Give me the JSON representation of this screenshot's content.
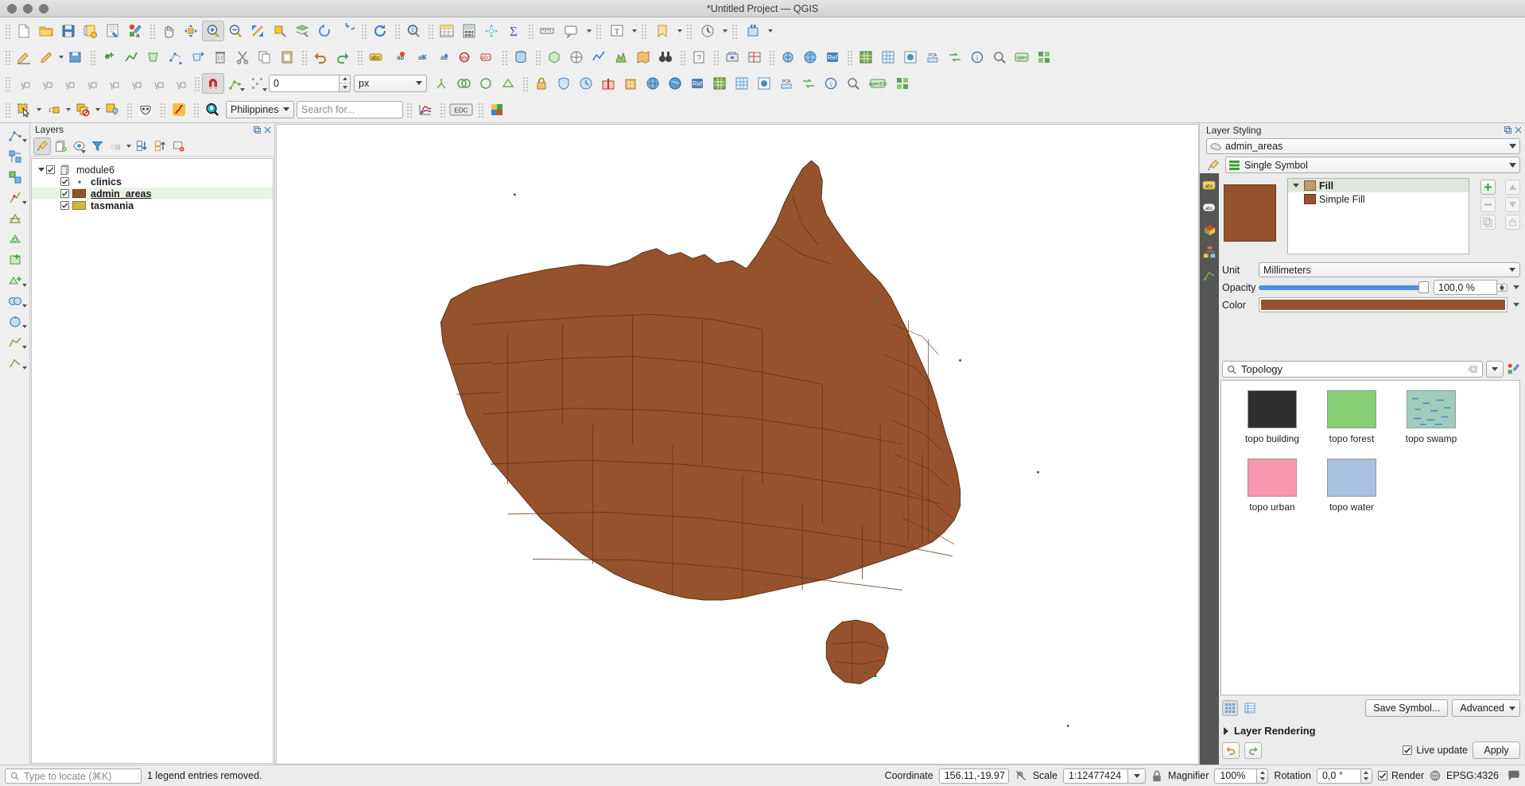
{
  "window": {
    "title": "*Untitled Project — QGIS"
  },
  "toolbar2": {
    "offset_value": "0",
    "unit_value": "px"
  },
  "toolbar3": {
    "region_value": "Philippines",
    "search_placeholder": "Search for..."
  },
  "layers_panel": {
    "title": "Layers",
    "tree": [
      {
        "label": "module6",
        "type": "group",
        "checked": true,
        "symbol": "none"
      },
      {
        "label": "clinics",
        "type": "layer",
        "checked": true,
        "symbol": "point",
        "color": "#4a7a3a"
      },
      {
        "label": "admin_areas",
        "type": "layer",
        "checked": true,
        "symbol": "fill",
        "color": "#96522c",
        "selected": true
      },
      {
        "label": "tasmania",
        "type": "layer",
        "checked": true,
        "symbol": "fill",
        "color": "#d4b63c"
      }
    ]
  },
  "styling": {
    "title": "Layer Styling",
    "layer_name": "admin_areas",
    "renderer": "Single Symbol",
    "symbol_layers": [
      {
        "label": "Fill",
        "indent": 0,
        "color": "#c39a6b",
        "selected": true
      },
      {
        "label": "Simple Fill",
        "indent": 1,
        "color": "#96522c",
        "selected": false
      }
    ],
    "properties": {
      "unit_label": "Unit",
      "unit_value": "Millimeters",
      "opacity_label": "Opacity",
      "opacity_value": "100,0 %",
      "opacity_percent": 100,
      "color_label": "Color",
      "color_value": "#96522c"
    },
    "symbol_browser": {
      "search_value": "Topology",
      "items": [
        {
          "name": "topo building",
          "color": "#2e2e2e"
        },
        {
          "name": "topo forest",
          "color": "#85ce74"
        },
        {
          "name": "topo swamp",
          "color": "#9ecdbc"
        },
        {
          "name": "topo urban",
          "color": "#fa96ae"
        },
        {
          "name": "topo water",
          "color": "#a9c1e0"
        }
      ]
    },
    "save_symbol_label": "Save Symbol...",
    "advanced_label": "Advanced",
    "layer_rendering_label": "Layer Rendering",
    "live_update_label": "Live update",
    "live_update_checked": true,
    "apply_label": "Apply"
  },
  "statusbar": {
    "locate_placeholder": "Type to locate (⌘K)",
    "message": "1 legend entries removed.",
    "coordinate_label": "Coordinate",
    "coordinate_value": "156.11,-19.97",
    "scale_label": "Scale",
    "scale_value": "1:12477424",
    "magnifier_label": "Magnifier",
    "magnifier_value": "100%",
    "rotation_label": "Rotation",
    "rotation_value": "0,0 °",
    "render_label": "Render",
    "render_checked": true,
    "crs_label": "EPSG:4326"
  },
  "map": {
    "fill_color": "#96522c",
    "stroke_color": "#5e3418"
  }
}
